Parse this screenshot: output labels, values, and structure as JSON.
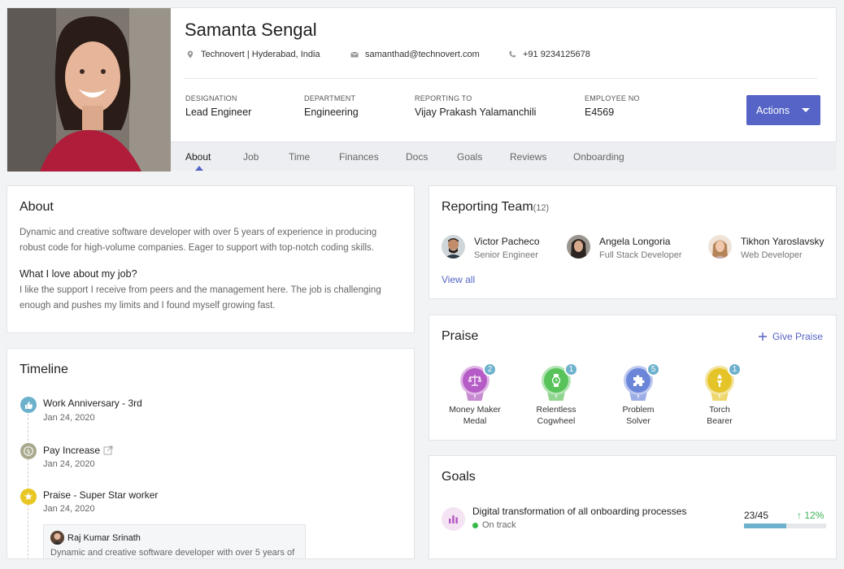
{
  "profile": {
    "name": "Samanta Sengal",
    "location": "Technovert | Hyderabad, India",
    "email": "samanthad@technovert.com",
    "phone": "+91 9234125678",
    "fields": [
      {
        "label": "DESIGNATION",
        "value": "Lead Engineer"
      },
      {
        "label": "DEPARTMENT",
        "value": "Engineering"
      },
      {
        "label": "REPORTING TO",
        "value": "Vijay Prakash Yalamanchili"
      },
      {
        "label": "EMPLOYEE NO",
        "value": "E4569"
      }
    ],
    "actions_label": "Actions"
  },
  "tabs": [
    "About",
    "Job",
    "Time",
    "Finances",
    "Docs",
    "Goals",
    "Reviews",
    "Onboarding"
  ],
  "active_tab": "About",
  "about": {
    "title": "About",
    "bio": "Dynamic and creative software developer with over 5 years of experience in producing robust code for high-volume companies. Eager to support with top-notch coding skills.",
    "love_heading": "What I love about my job?",
    "love_text": "I like the support I receive from peers and the management here. The job is challenging enough and pushes my limits and I found myself growing fast."
  },
  "timeline": {
    "title": "Timeline",
    "items": [
      {
        "title": "Work Anniversary - 3rd",
        "date": "Jan 24, 2020",
        "icon": "thumbs-up-icon",
        "color": "#6db1cc"
      },
      {
        "title": "Pay Increase",
        "date": "Jan 24, 2020",
        "icon": "dollar-icon",
        "color": "#a9a98e"
      },
      {
        "title": "Praise - Super Star worker",
        "date": "Jan 24, 2020",
        "icon": "star-medal-icon",
        "color": "#e8c623"
      }
    ],
    "comment": {
      "author": "Raj Kumar Srinath",
      "text": "Dynamic and creative software developer with over 5 years of"
    }
  },
  "team": {
    "title": "Reporting Team",
    "count": "(12)",
    "members": [
      {
        "name": "Victor Pacheco",
        "role": "Senior Engineer"
      },
      {
        "name": "Angela Longoria",
        "role": "Full Stack Developer"
      },
      {
        "name": "Tikhon Yaroslavsky",
        "role": "Web Developer"
      }
    ],
    "view_all": "View all"
  },
  "praise": {
    "title": "Praise",
    "give_label": "Give Praise",
    "badges": [
      {
        "line1": "Money Maker",
        "line2": "Medal",
        "count": "2",
        "color": "#b65cc6",
        "icon": "scales-icon"
      },
      {
        "line1": "Relentless",
        "line2": "Cogwheel",
        "count": "1",
        "color": "#58c35a",
        "icon": "watch-icon"
      },
      {
        "line1": "Problem",
        "line2": "Solver",
        "count": "5",
        "color": "#6b86d8",
        "icon": "puzzle-icon"
      },
      {
        "line1": "Torch",
        "line2": "Bearer",
        "count": "1",
        "color": "#e5c42a",
        "icon": "torch-icon"
      }
    ]
  },
  "goals": {
    "title": "Goals",
    "items": [
      {
        "title": "Digital transformation of all onboarding processes",
        "status": "On track",
        "progress": "23/45",
        "delta": "12%",
        "completed": 23,
        "total": 45
      }
    ]
  }
}
